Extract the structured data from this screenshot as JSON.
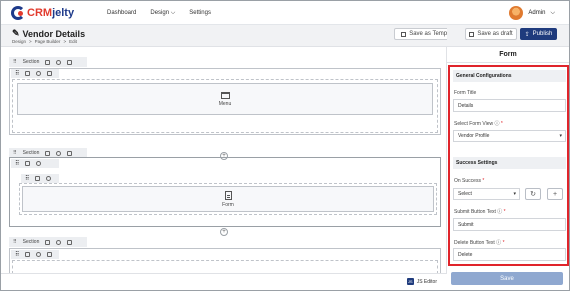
{
  "brand": {
    "crm": "CRM",
    "jelty": "jelty"
  },
  "nav": {
    "dashboard": "Dashboard",
    "design": "Design",
    "settings": "Settings",
    "design_caret": "⌵"
  },
  "user": {
    "name": "Admin",
    "caret": "⌵"
  },
  "header": {
    "title": "Vendor Details",
    "edit_icon": "✎",
    "breadcrumb": [
      "Design",
      ">",
      "Page Builder",
      ">",
      "Edit"
    ],
    "save_template_label": "Save as Template",
    "save_draft_label": "Save as draft",
    "publish_label": "Publish"
  },
  "panel": {
    "title": "Form"
  },
  "canvas": {
    "section_label": "Section",
    "widgets": {
      "menu": "Menu",
      "form": "Form"
    },
    "plus": "+"
  },
  "bottom": {
    "js_editor_label": "JS Editor",
    "js_icon": "JS",
    "save_label": "Save"
  },
  "config": {
    "general_title": "General Configurations",
    "form_title_label": "Form Title",
    "form_title_value": "Details",
    "form_view_label": "Select Form View",
    "form_view_value": "Vendor Profile",
    "success_title": "Success Settings",
    "on_success_label": "On Success",
    "on_success_value": "Select",
    "submit_text_label": "Submit Button Text",
    "submit_text_value": "Submit",
    "delete_text_label": "Delete Button Text",
    "delete_text_value": "Delete",
    "required_mark": "*",
    "info_mark": "ⓘ",
    "refresh": "↻",
    "add": "+",
    "caret": "▾"
  },
  "colors": {
    "brand_navy": "#1f3b7d",
    "brand_red": "#e23b2e",
    "highlight": "#e0242b",
    "save_button": "#8fa8d0"
  }
}
